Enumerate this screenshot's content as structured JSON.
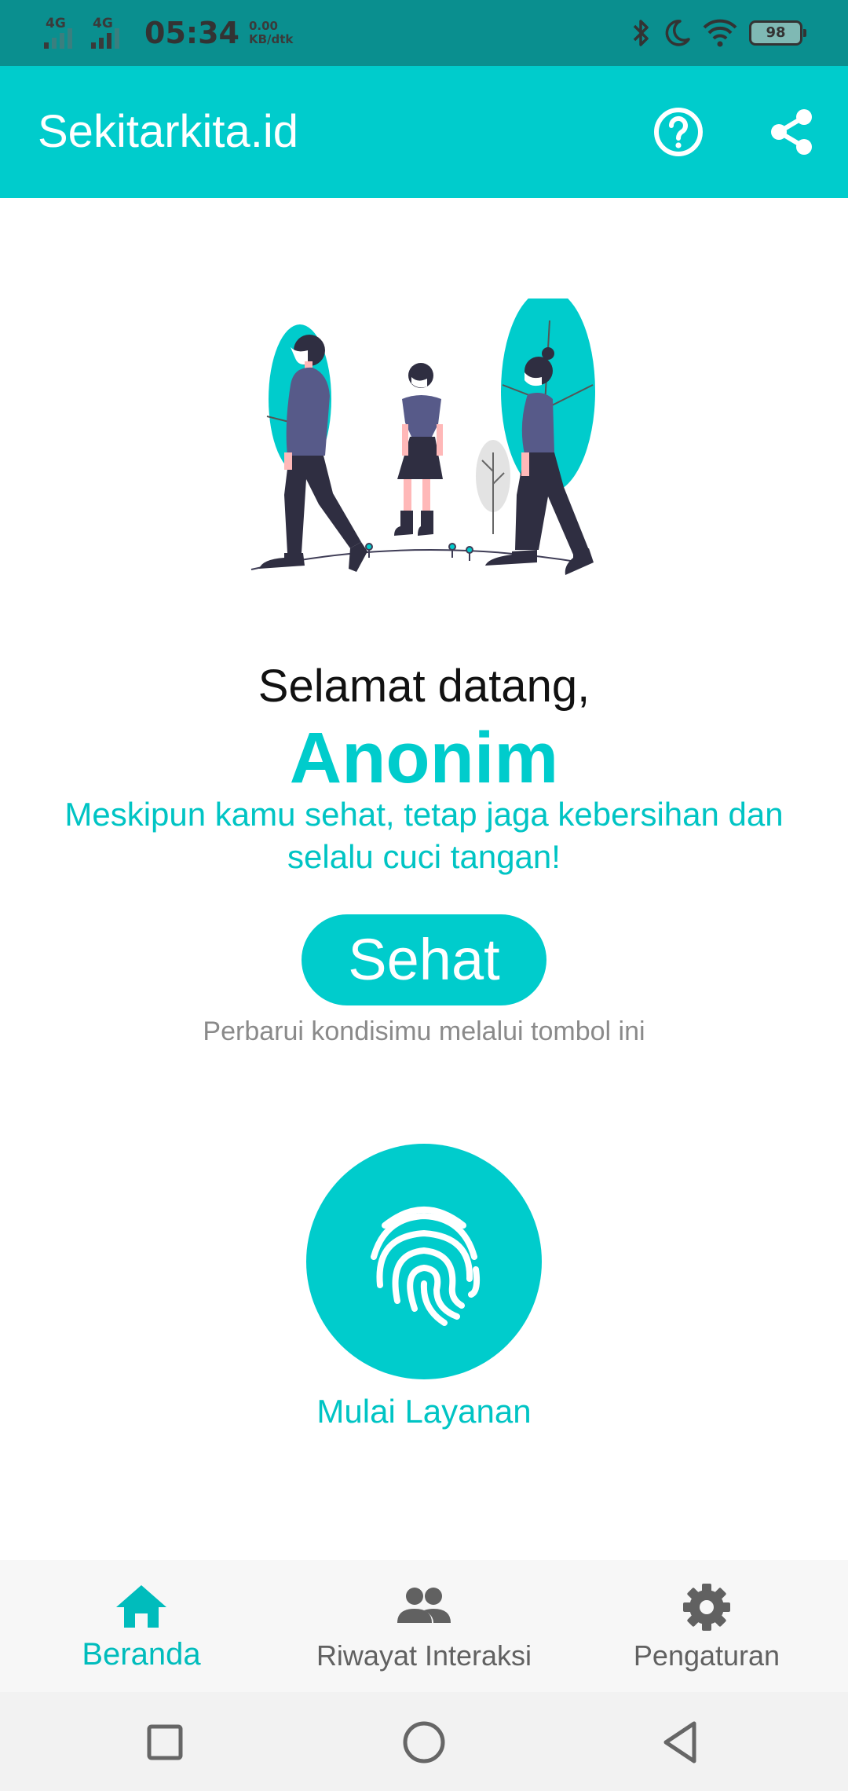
{
  "status_bar": {
    "network1": "4G",
    "network2": "4G",
    "time": "05:34",
    "speed_value": "0.00",
    "speed_unit": "KB/dtk",
    "battery": "98",
    "icons": [
      "bluetooth-icon",
      "moon-icon",
      "wifi-icon",
      "battery-icon"
    ]
  },
  "app_bar": {
    "title": "Sekitarkita.id",
    "help_icon": "help-circle-icon",
    "share_icon": "share-icon"
  },
  "main": {
    "welcome": "Selamat datang,",
    "user_name": "Anonim",
    "message": "Meskipun kamu sehat, tetap jaga kebersihan dan selalu cuci tangan!",
    "status_button": "Sehat",
    "hint": "Perbarui kondisimu melalui tombol ini",
    "start_label": "Mulai Layanan",
    "start_icon": "fingerprint-icon"
  },
  "bottom_nav": {
    "items": [
      {
        "label": "Beranda",
        "icon": "home-icon",
        "active": true
      },
      {
        "label": "Riwayat Interaksi",
        "icon": "people-icon",
        "active": false
      },
      {
        "label": "Pengaturan",
        "icon": "gear-icon",
        "active": false
      }
    ]
  },
  "system_nav": [
    "recents-square-icon",
    "home-circle-icon",
    "back-triangle-icon"
  ],
  "colors": {
    "accent": "#00cccc",
    "status_bar": "#0a8f8f",
    "hint_text": "#8a8a8a",
    "nav_inactive": "#616161"
  }
}
